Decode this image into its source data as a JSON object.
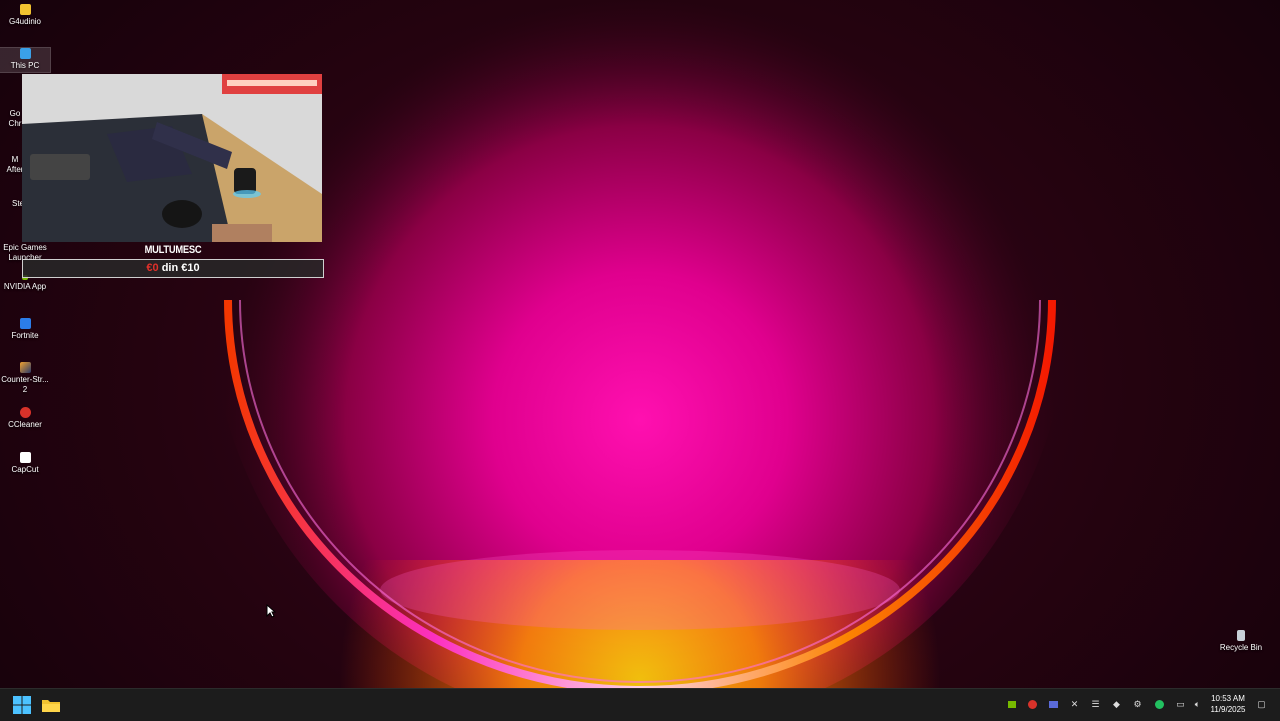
{
  "desktop": {
    "icons": [
      {
        "label": "G4udinio",
        "icon": "folder-icon"
      },
      {
        "label": "This PC",
        "icon": "monitor-icon",
        "selected": true
      },
      {
        "label": "Go\nChr",
        "icon": "chrome-icon"
      },
      {
        "label": "M\nAfter",
        "icon": "app-icon"
      },
      {
        "label": "Ste",
        "icon": "steam-icon"
      },
      {
        "label": "Epic Games Launcher",
        "icon": "epic-icon"
      },
      {
        "label": "NVIDIA App",
        "icon": "nvidia-icon"
      },
      {
        "label": "Fortnite",
        "icon": "fortnite-icon"
      },
      {
        "label": "Counter-Str... 2",
        "icon": "cs2-icon"
      },
      {
        "label": "CCleaner",
        "icon": "ccleaner-icon"
      },
      {
        "label": "CapCut",
        "icon": "capcut-icon"
      }
    ],
    "recycle_bin": {
      "label": "Recycle Bin",
      "icon": "recycle-bin-icon"
    }
  },
  "widget": {
    "title": "MULTUMESC",
    "current": "€0",
    "separator": " din ",
    "goal": "€10",
    "progress": 0
  },
  "taskbar": {
    "start_icon": "windows-start-icon",
    "pinned": [
      "file-explorer-icon"
    ],
    "tray": [
      "nvidia-tray-icon",
      "ccleaner-tray-icon",
      "display-tray-icon",
      "pen-tray-icon",
      "app-tray-icon",
      "steam-tray-icon",
      "settings-tray-icon",
      "security-tray-icon",
      "network-icon",
      "volume-icon"
    ],
    "time": "10:53 AM",
    "date": "11/9/2025",
    "notification_icon": "notification-icon"
  },
  "colors": {
    "accent_pink": "#e8009a",
    "accent_orange": "#ff5a00",
    "goal_current": "#e0302a"
  }
}
